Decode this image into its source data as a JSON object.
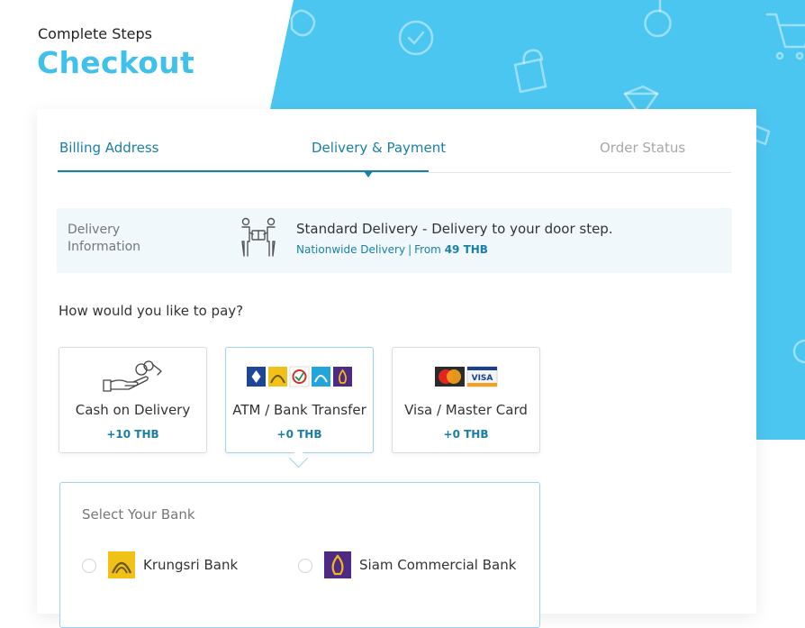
{
  "header": {
    "subtitle": "Complete Steps",
    "title": "Checkout"
  },
  "colors": {
    "accent": "#3fc1ec",
    "primary": "#1a7fa8",
    "delivery_bg": "#f0f8fc"
  },
  "steps": [
    {
      "label": "Billing Address",
      "state": "done"
    },
    {
      "label": "Delivery & Payment",
      "state": "active"
    },
    {
      "label": "Order Status",
      "state": "todo"
    }
  ],
  "delivery": {
    "label": "Delivery Information",
    "icon": "delivery-handover-icon",
    "title": "Standard Delivery - Delivery to your door step.",
    "subtitle_left": "Nationwide Delivery",
    "separator": "|",
    "subtitle_from": "From",
    "subtitle_price": "49 THB"
  },
  "payment": {
    "question": "How would you like to pay?",
    "options": [
      {
        "label": "Cash on Delivery",
        "price": "+10 THB",
        "icon": "cash-hand-icon"
      },
      {
        "label": "ATM / Bank Transfer",
        "price": "+0 THB",
        "icon": "bank-logos-icon",
        "selected": true
      },
      {
        "label": "Visa / Master Card",
        "price": "+0 THB",
        "icon": "card-logos-icon"
      }
    ]
  },
  "bank_select": {
    "title": "Select Your Bank",
    "banks": [
      {
        "name": "Krungsri Bank",
        "icon": "krungsri-logo-icon"
      },
      {
        "name": "Siam Commercial Bank",
        "icon": "scb-logo-icon"
      }
    ]
  }
}
